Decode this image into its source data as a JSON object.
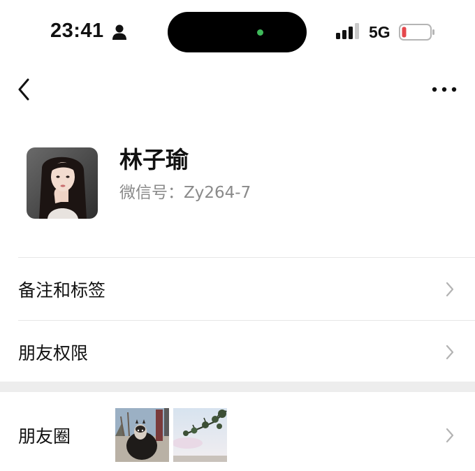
{
  "status_bar": {
    "time": "23:41",
    "network": "5G",
    "battery_color": "#e5484d",
    "island_indicator_color": "#3fb95a"
  },
  "nav": {
    "back_icon": "chevron-left-icon",
    "more_icon": "more-dots-icon"
  },
  "profile": {
    "name": "林子瑜",
    "wechat_id": "微信号：Zy264-7"
  },
  "rows": [
    {
      "label": "备注和标签"
    },
    {
      "label": "朋友权限"
    }
  ],
  "moments": {
    "label": "朋友圈",
    "thumbnails": [
      "alpaca-photo",
      "tree-sky-photo"
    ]
  },
  "colors": {
    "divider": "#e6e6e6",
    "section_gap": "#ededed",
    "secondary_text": "#8a8a8a"
  }
}
